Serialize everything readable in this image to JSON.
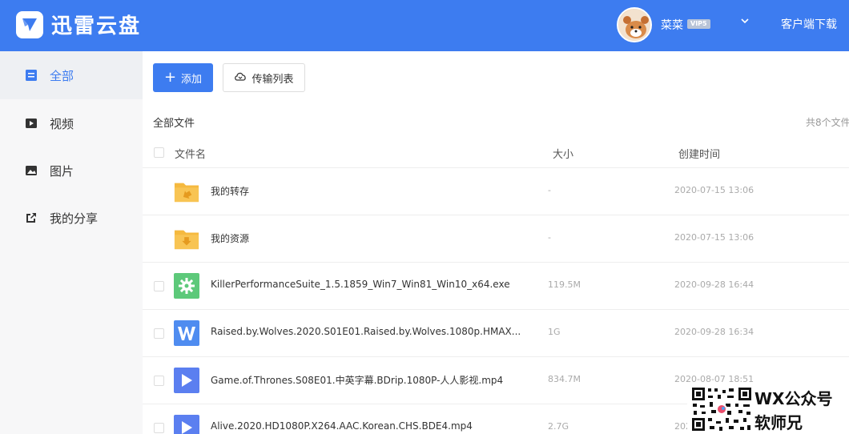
{
  "app": {
    "title": "迅雷云盘"
  },
  "header": {
    "username": "菜菜",
    "vip_label": "VIP5",
    "client_download": "客户端下载"
  },
  "sidebar": {
    "items": [
      {
        "label": "全部",
        "icon": "list-icon",
        "active": true
      },
      {
        "label": "视频",
        "icon": "video-icon",
        "active": false
      },
      {
        "label": "图片",
        "icon": "image-icon",
        "active": false
      },
      {
        "label": "我的分享",
        "icon": "share-icon",
        "active": false
      }
    ]
  },
  "toolbar": {
    "add_label": "添加",
    "transfer_label": "传输列表"
  },
  "breadcrumb": "全部文件",
  "file_count": "共8个文件",
  "columns": {
    "name": "文件名",
    "size": "大小",
    "time": "创建时间"
  },
  "files": [
    {
      "name": "我的转存",
      "size": "-",
      "time": "2020-07-15 13:06",
      "icon": "folder-share-icon"
    },
    {
      "name": "我的资源",
      "size": "-",
      "time": "2020-07-15 13:06",
      "icon": "folder-download-icon"
    },
    {
      "name": "KillerPerformanceSuite_1.5.1859_Win7_Win81_Win10_x64.exe",
      "size": "119.5M",
      "time": "2020-09-28 16:44",
      "icon": "exe-gear-icon"
    },
    {
      "name": "Raised.by.Wolves.2020.S01E01.Raised.by.Wolves.1080p.HMAX...",
      "size": "1G",
      "time": "2020-09-28 16:34",
      "icon": "word-doc-icon"
    },
    {
      "name": "Game.of.Thrones.S08E01.中英字幕.BDrip.1080P-人人影视.mp4",
      "size": "834.7M",
      "time": "2020-08-07 18:51",
      "icon": "video-file-icon"
    },
    {
      "name": "Alive.2020.HD1080P.X264.AAC.Korean.CHS.BDE4.mp4",
      "size": "2.7G",
      "time": "2020-08-07 18:51",
      "icon": "video-file-icon"
    }
  ],
  "watermark": {
    "line1": "WX公众号",
    "line2": "软师兄"
  },
  "colors": {
    "accent": "#3d7cf0",
    "folder": "#f5b93f",
    "exe": "#5dc97a",
    "doc": "#4f8cf0",
    "video": "#5b7ff0"
  }
}
